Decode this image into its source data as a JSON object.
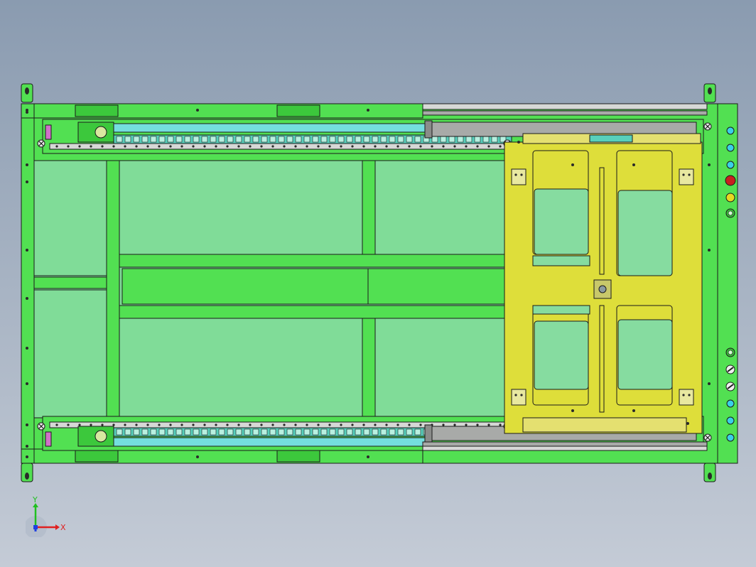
{
  "view": {
    "background_top": "#8a9bb0",
    "background_bottom": "#c4cbd6"
  },
  "colors": {
    "frame_green": "#52e052",
    "frame_green_dark": "#3cc83c",
    "panel_green": "#80dc98",
    "carriage_yellow": "#dede3a",
    "slot_green": "#86dca0",
    "rail_gray": "#a8aaa8",
    "rail_light": "#d6d8d6",
    "chain_teal": "#58d0bc",
    "belt_cyan": "#74dede",
    "pink_block": "#d070c8",
    "outline": "#1a1a1a",
    "hole_fill": "#2a2a2a",
    "btn_cyan": "#3ad0e8",
    "btn_red": "#c82020",
    "btn_yellow": "#e8d820",
    "btn_green_ring": "#3ab83a"
  },
  "side_panel_buttons": [
    {
      "icon": "indicator-light-icon",
      "kind": "cyan"
    },
    {
      "icon": "indicator-light-icon",
      "kind": "cyan"
    },
    {
      "icon": "indicator-light-icon",
      "kind": "cyan"
    },
    {
      "icon": "emergency-stop-icon",
      "kind": "red"
    },
    {
      "icon": "indicator-light-icon",
      "kind": "yellow"
    },
    {
      "icon": "indicator-light-icon",
      "kind": "ring"
    },
    {
      "icon": "indicator-light-icon",
      "kind": "ring"
    },
    {
      "icon": "selector-switch-icon",
      "kind": "switch"
    },
    {
      "icon": "selector-switch-icon",
      "kind": "switch"
    },
    {
      "icon": "indicator-light-icon",
      "kind": "cyan"
    },
    {
      "icon": "indicator-light-icon",
      "kind": "cyan"
    },
    {
      "icon": "indicator-light-icon",
      "kind": "cyan"
    }
  ],
  "triad": {
    "x_label": "X",
    "y_label": "Y",
    "x_color": "#e02020",
    "y_color": "#20c020",
    "z_color": "#2040e0"
  }
}
